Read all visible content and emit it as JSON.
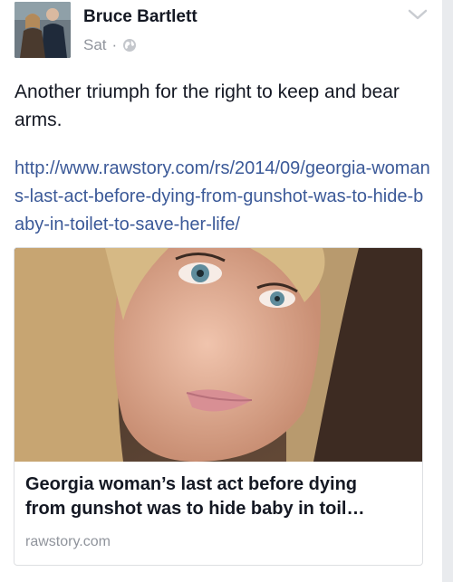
{
  "post": {
    "author": "Bruce Bartlett",
    "time": "Sat",
    "separator": "·",
    "privacy_icon": "globe-icon",
    "menu_icon": "chevron-down-icon",
    "text": "Another triumph for the right to keep and bear arms.",
    "link_url": "http://www.rawstory.com/rs/2014/09/georgia-womans-last-act-before-dying-from-gunshot-was-to-hide-baby-in-toilet-to-save-her-life/"
  },
  "link_preview": {
    "title": "Georgia woman’s last act before dying\nfrom gunshot was to hide baby in toil…",
    "domain": "rawstory.com"
  },
  "colors": {
    "link": "#3b5998",
    "meta": "#90949c",
    "text": "#141823"
  }
}
